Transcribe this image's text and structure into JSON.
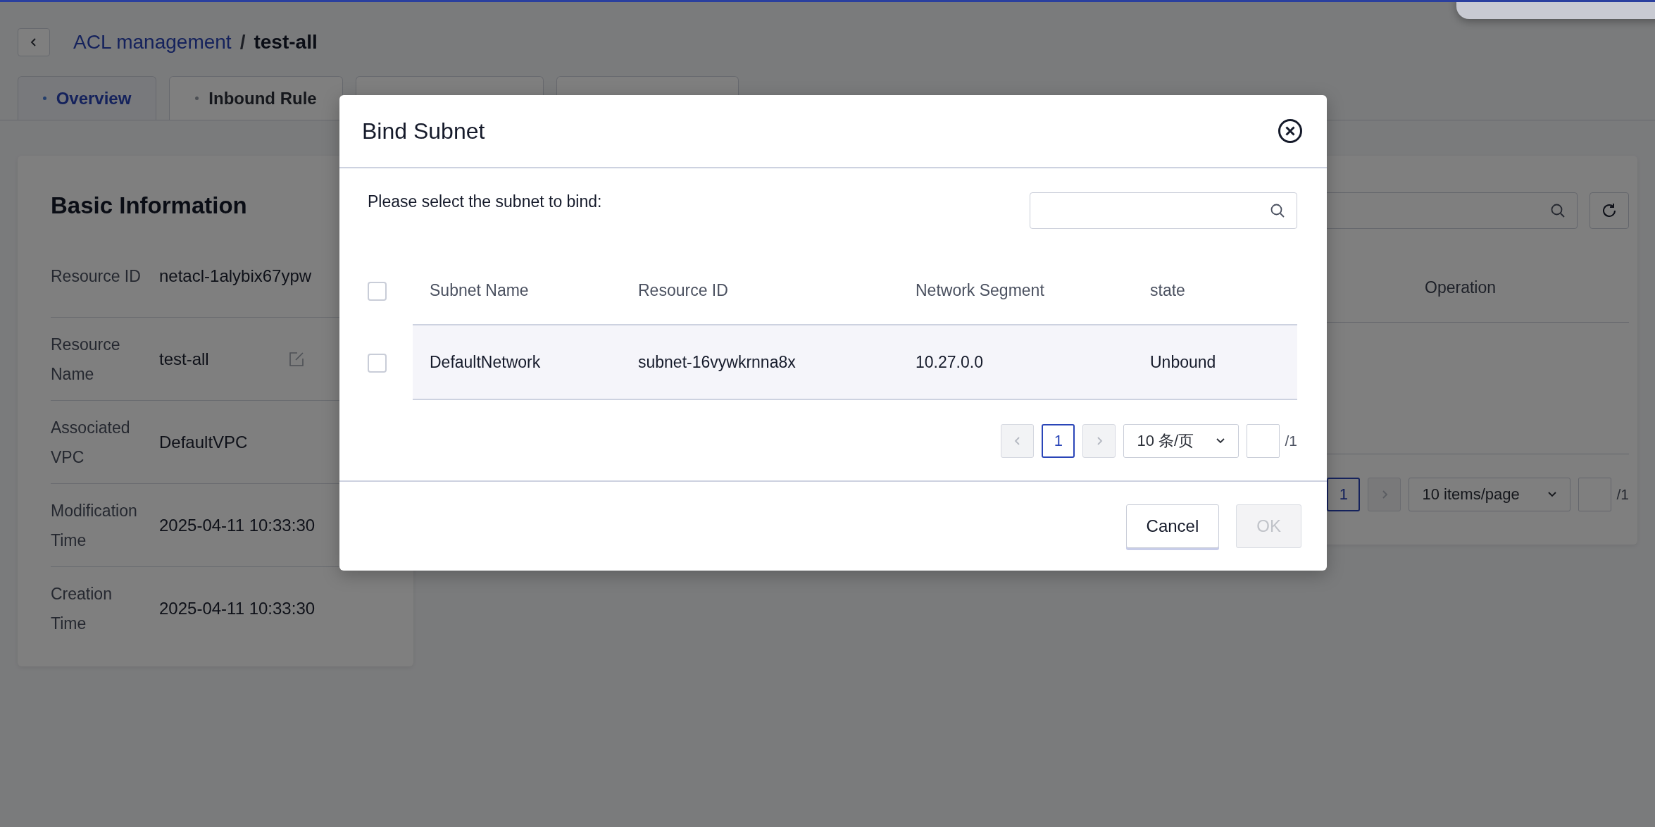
{
  "breadcrumb": {
    "parent": "ACL management",
    "separator": "/",
    "current": "test-all"
  },
  "tabs": [
    {
      "label": "Overview",
      "selected": true
    },
    {
      "label": "Inbound Rule",
      "selected": false
    }
  ],
  "basic_info": {
    "title": "Basic Information",
    "fields": [
      {
        "label": "Resource ID",
        "value": "netacl-1alybix67ypw",
        "editable": false
      },
      {
        "label": "Resource Name",
        "value": "test-all",
        "editable": true
      },
      {
        "label": "Associated VPC",
        "value": "DefaultVPC",
        "editable": false
      },
      {
        "label": "Modification Time",
        "value": "2025-04-11 10:33:30",
        "editable": false
      },
      {
        "label": "Creation Time",
        "value": "2025-04-11 10:33:30",
        "editable": false
      }
    ]
  },
  "rule_panel": {
    "column_header": "Operation",
    "pagination": {
      "pages": [
        {
          "label": "1",
          "selected": true
        }
      ],
      "page_size": "10 items/page",
      "total": "/1"
    }
  },
  "dialog": {
    "title": "Bind Subnet",
    "prompt": "Please select the subnet to bind:",
    "table": {
      "select_all_checked": false,
      "columns": [
        "Subnet Name",
        "Resource ID",
        "Network Segment",
        "state"
      ],
      "rows": [
        {
          "checked": false,
          "cells": [
            "DefaultNetwork",
            "subnet-16vywkrnna8x",
            "10.27.0.0",
            "Unbound"
          ]
        }
      ]
    },
    "pagination": {
      "pages": [
        {
          "label": "1",
          "selected": true
        }
      ],
      "page_size": "10 条/页",
      "total": "/1"
    },
    "buttons": [
      {
        "label": "Cancel",
        "disabled": false
      },
      {
        "label": "OK",
        "disabled": true
      }
    ]
  }
}
